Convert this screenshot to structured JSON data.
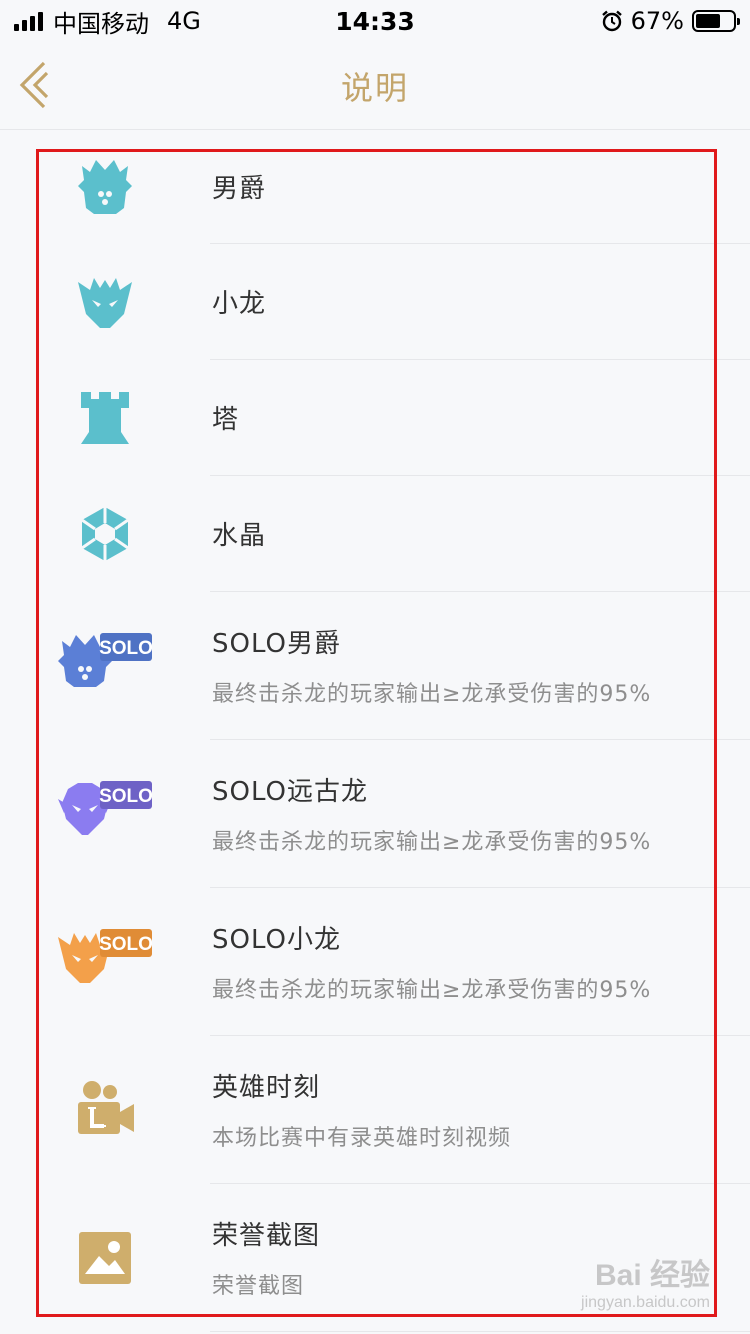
{
  "status_bar": {
    "carrier": "中国移动",
    "network": "4G",
    "time": "14:33",
    "battery_percent": "67%",
    "battery_level": 0.67
  },
  "nav": {
    "title": "说明"
  },
  "items": [
    {
      "title": "男爵",
      "desc": "",
      "icon": "baron-icon",
      "color": "#5bbfcc"
    },
    {
      "title": "小龙",
      "desc": "",
      "icon": "dragon-icon",
      "color": "#5bbfcc"
    },
    {
      "title": "塔",
      "desc": "",
      "icon": "tower-icon",
      "color": "#5bbfcc"
    },
    {
      "title": "水晶",
      "desc": "",
      "icon": "crystal-icon",
      "color": "#5bbfcc"
    },
    {
      "title": "SOLO男爵",
      "desc": "最终击杀龙的玩家输出≥龙承受伤害的95%",
      "icon": "solo-baron-icon",
      "color": "#5b7fd6",
      "badge": "SOLO"
    },
    {
      "title": "SOLO远古龙",
      "desc": "最终击杀龙的玩家输出≥龙承受伤害的95%",
      "icon": "solo-elder-dragon-icon",
      "color": "#8b7cf0",
      "badge": "SOLO"
    },
    {
      "title": "SOLO小龙",
      "desc": "最终击杀龙的玩家输出≥龙承受伤害的95%",
      "icon": "solo-dragon-icon",
      "color": "#f3a04a",
      "badge": "SOLO"
    },
    {
      "title": "英雄时刻",
      "desc": "本场比赛中有录英雄时刻视频",
      "icon": "hero-moment-icon",
      "color": "#cfae6c"
    },
    {
      "title": "荣誉截图",
      "desc": "荣誉截图",
      "icon": "honor-screenshot-icon",
      "color": "#cfae6c"
    }
  ],
  "watermark": {
    "main": "Bai 经验",
    "sub": "jingyan.baidu.com"
  },
  "colors": {
    "accent": "#c3a56b",
    "highlight": "#e0191b",
    "teal": "#5bbfcc"
  }
}
